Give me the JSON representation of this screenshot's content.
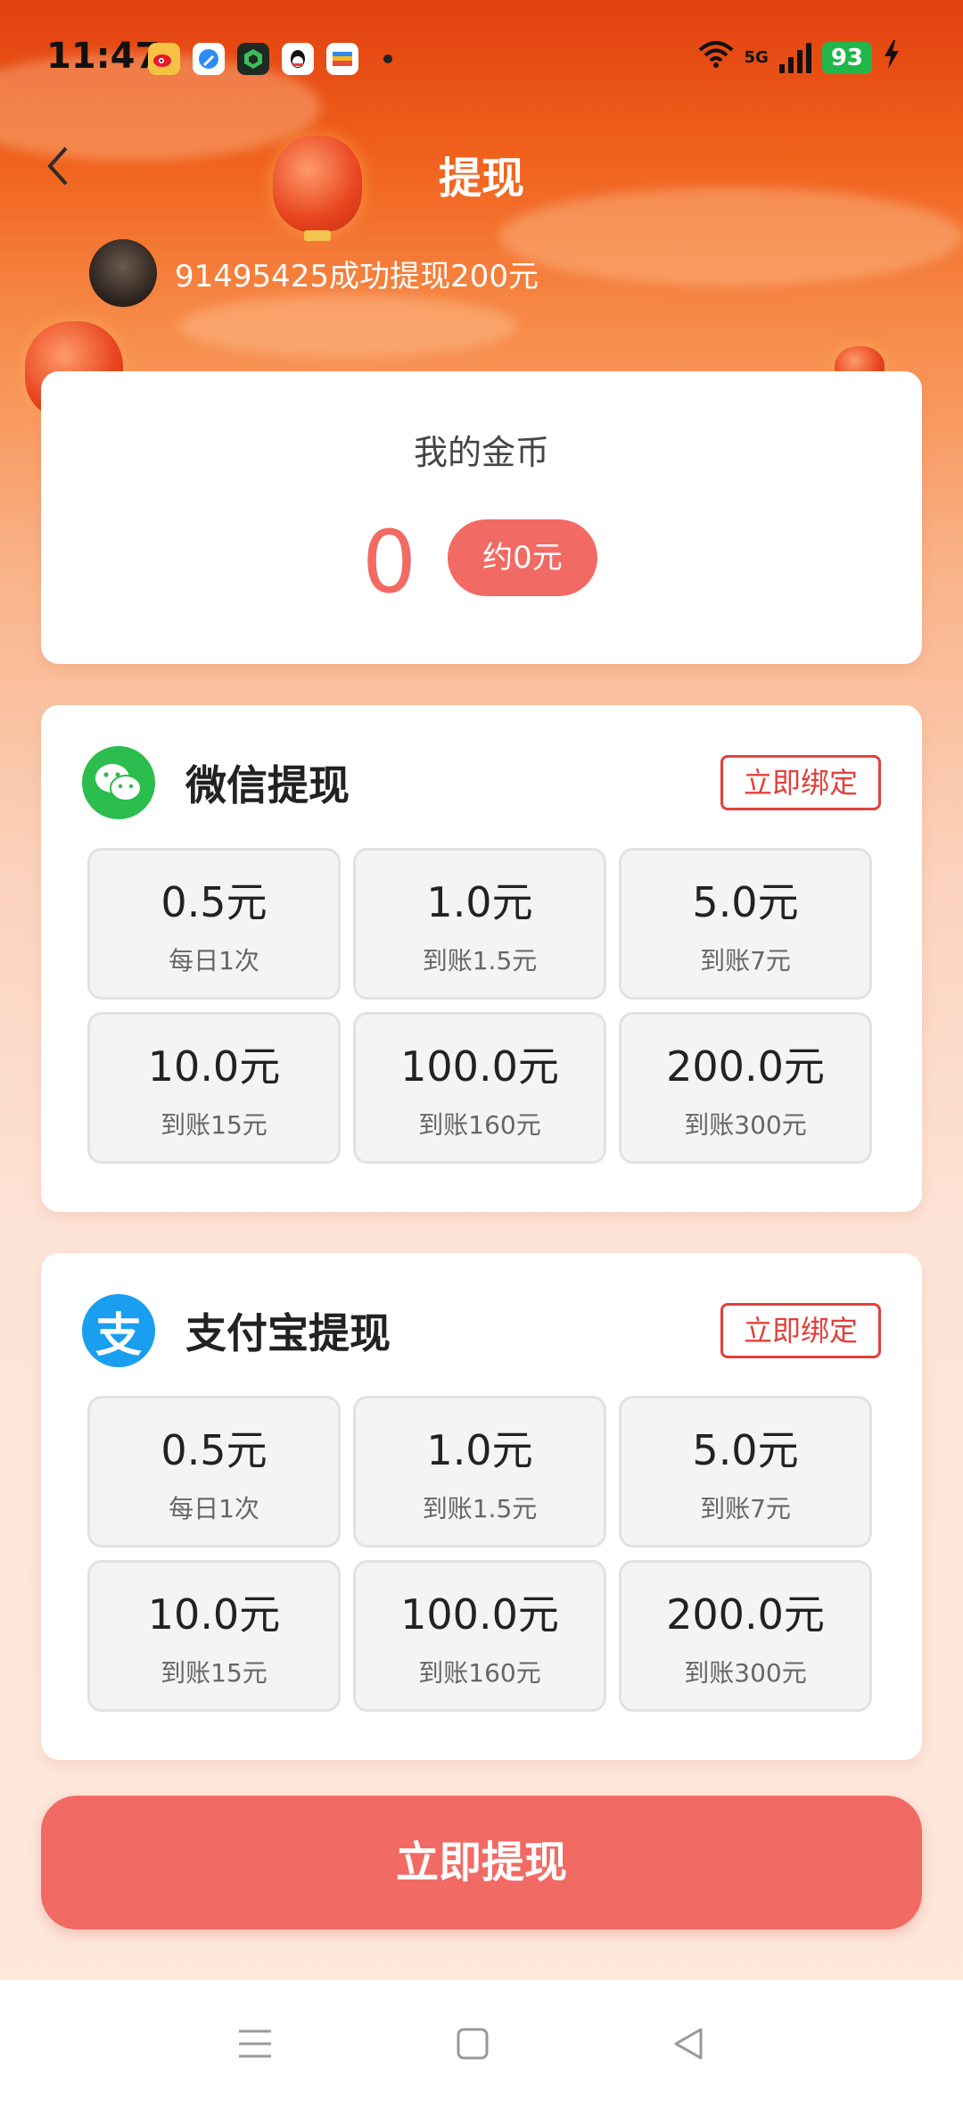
{
  "status_bar": {
    "time": "11:47",
    "network": "5G",
    "battery": "93"
  },
  "header": {
    "title": "提现",
    "back_icon": "chevron-left-icon"
  },
  "ticker": {
    "text": "91495425成功提现200元"
  },
  "coins": {
    "label": "我的金币",
    "value": "0",
    "approx": "约0元"
  },
  "wechat": {
    "title": "微信提现",
    "bind_label": "立即绑定",
    "options": [
      {
        "amount": "0.5元",
        "sub": "每日1次"
      },
      {
        "amount": "1.0元",
        "sub": "到账1.5元"
      },
      {
        "amount": "5.0元",
        "sub": "到账7元"
      },
      {
        "amount": "10.0元",
        "sub": "到账15元"
      },
      {
        "amount": "100.0元",
        "sub": "到账160元"
      },
      {
        "amount": "200.0元",
        "sub": "到账300元"
      }
    ]
  },
  "alipay": {
    "title": "支付宝提现",
    "logo_glyph": "支",
    "bind_label": "立即绑定",
    "options": [
      {
        "amount": "0.5元",
        "sub": "每日1次"
      },
      {
        "amount": "1.0元",
        "sub": "到账1.5元"
      },
      {
        "amount": "5.0元",
        "sub": "到账7元"
      },
      {
        "amount": "10.0元",
        "sub": "到账15元"
      },
      {
        "amount": "100.0元",
        "sub": "到账160元"
      },
      {
        "amount": "200.0元",
        "sub": "到账300元"
      }
    ]
  },
  "withdraw_button": "立即提现",
  "colors": {
    "accent": "#f26a64",
    "bind_border": "#e2403c",
    "wechat_green": "#2bbd4d",
    "alipay_blue": "#1a9ff0"
  }
}
